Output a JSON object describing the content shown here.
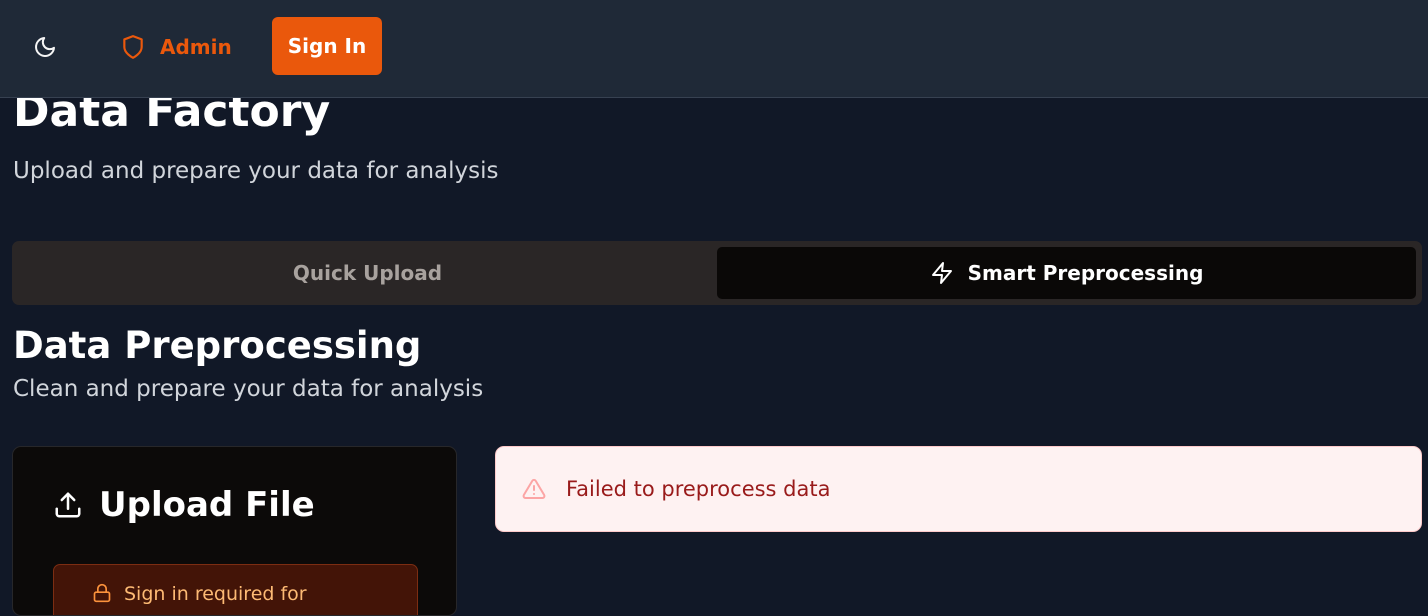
{
  "header": {
    "theme_icon": "moon-icon",
    "admin_icon": "shield-icon",
    "admin_label": "Admin",
    "signin_label": "Sign In",
    "accent_color": "#ea580c"
  },
  "page": {
    "title": "Data Factory",
    "subtitle": "Upload and prepare your data for analysis"
  },
  "tabs": [
    {
      "label": "Quick Upload",
      "active": false
    },
    {
      "label": "Smart Preprocessing",
      "icon": "zap-icon",
      "active": true
    }
  ],
  "section": {
    "title": "Data Preprocessing",
    "subtitle": "Clean and prepare your data for analysis"
  },
  "upload_card": {
    "icon": "upload-icon",
    "title": "Upload File",
    "notice_icon": "lock-icon",
    "notice_text": "Sign in required for"
  },
  "alert": {
    "icon": "alert-triangle-icon",
    "message": "Failed to preprocess data"
  }
}
